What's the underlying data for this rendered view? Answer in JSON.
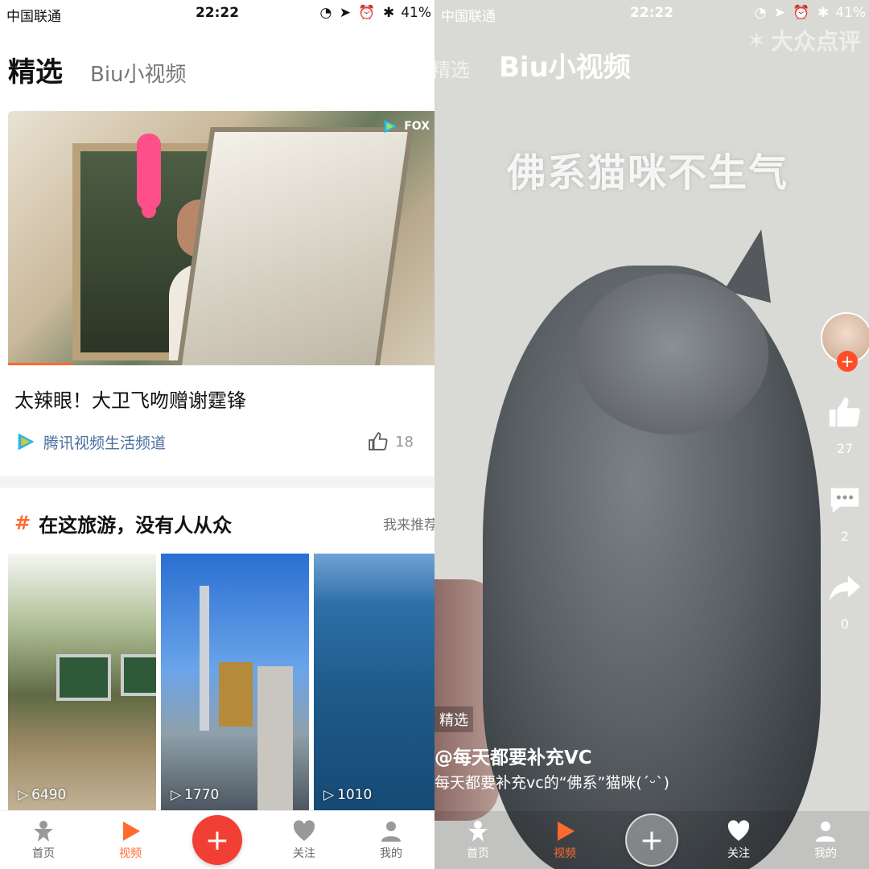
{
  "left": {
    "status": {
      "carrier": "中国联通",
      "time": "22:22",
      "battery": "41%"
    },
    "tabs": {
      "active": "精选",
      "inactive": "Biu小视频"
    },
    "hero": {
      "title": "太辣眼！大卫飞吻赠谢霆锋",
      "source": "腾讯视频生活频道",
      "likes": "18",
      "badge_text": "FOX"
    },
    "topic": {
      "title": "在这旅游，没有人从众",
      "more": "我来推荐"
    },
    "thumbs": [
      {
        "count": "6490"
      },
      {
        "count": "1770"
      },
      {
        "count": "1010"
      }
    ],
    "tabbar": {
      "home": "首页",
      "video": "视频",
      "follow": "关注",
      "me": "我的"
    }
  },
  "right": {
    "status": {
      "carrier": "中国联通",
      "time": "22:22",
      "battery": "41%"
    },
    "tabs": {
      "inactive": "精选",
      "active": "Biu小视频"
    },
    "watermark": "大众点评",
    "caption": "佛系猫咪不生气",
    "actions": {
      "likes": "27",
      "comments": "2",
      "shares": "0"
    },
    "tag": "精选",
    "author": "@每天都要补充VC",
    "desc": "每天都要补充vc的“佛系”猫咪(ˊᵕˋ)",
    "tabbar": {
      "home": "首页",
      "video": "视频",
      "follow": "关注",
      "me": "我的"
    }
  },
  "colors": {
    "accent": "#ff6a2f",
    "plus": "#f23f35",
    "source_link": "#4a6fa0"
  }
}
